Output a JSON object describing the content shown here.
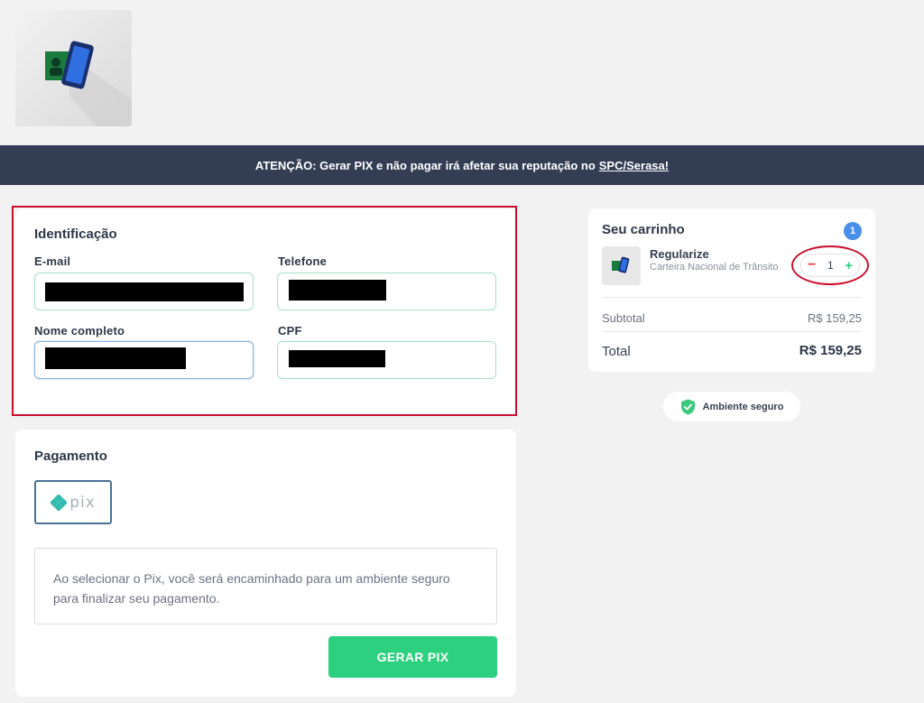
{
  "banner": {
    "text": "ATENÇÃO: Gerar PIX e não pagar irá afetar sua reputação no",
    "link": "SPC/Serasa!"
  },
  "identification": {
    "title": "Identificação",
    "email_label": "E-mail",
    "phone_label": "Telefone",
    "name_label": "Nome completo",
    "cpf_label": "CPF"
  },
  "payment": {
    "title": "Pagamento",
    "method": "pix",
    "info": "Ao selecionar o Pix, você será encaminhado para um ambiente seguro para finalizar seu pagamento.",
    "button": "GERAR PIX"
  },
  "cart": {
    "title": "Seu carrinho",
    "count": "1",
    "product_name": "Regularize",
    "product_sub": "Carteira Nacional de Trânsito",
    "quantity": "1",
    "subtotal_label": "Subtotal",
    "subtotal_value": "R$ 159,25",
    "total_label": "Total",
    "total_value": "R$ 159,25"
  },
  "secure": {
    "label": "Ambiente seguro"
  },
  "colors": {
    "banner": "#333d53",
    "accent_green": "#2dd07f",
    "badge_blue": "#4a8fe7",
    "annotation_red": "#c8102e"
  }
}
